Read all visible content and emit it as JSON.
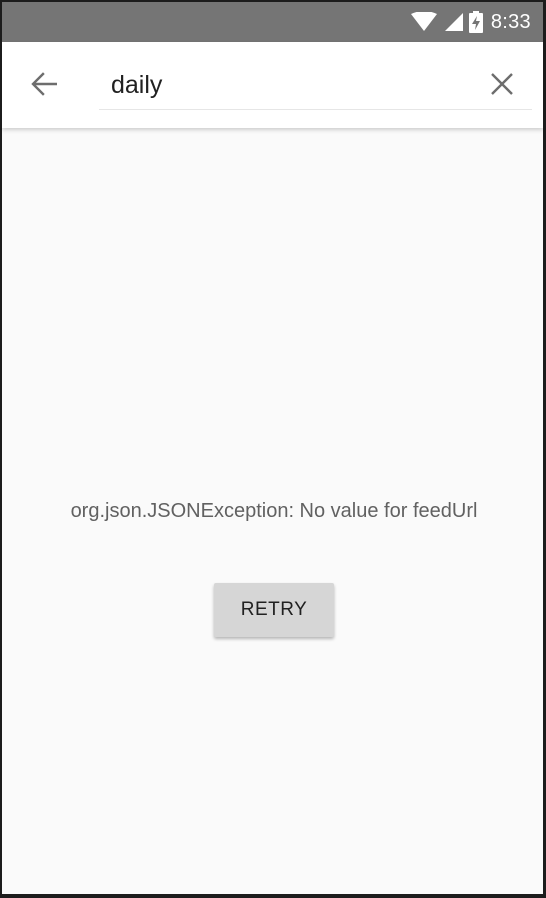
{
  "status_bar": {
    "time": "8:33",
    "icons": [
      "wifi-icon",
      "cellular-signal-icon",
      "battery-charging-icon"
    ]
  },
  "search_bar": {
    "back_icon": "arrow-back-icon",
    "query": "daily",
    "clear_icon": "close-icon"
  },
  "content": {
    "error_message": "org.json.JSONException: No value for feedUrl",
    "retry_label": "RETRY"
  },
  "colors": {
    "status_bar_bg": "#757575",
    "toolbar_bg": "#ffffff",
    "page_bg": "#fafafa",
    "button_bg": "#d6d6d6",
    "text_secondary": "#616161"
  }
}
